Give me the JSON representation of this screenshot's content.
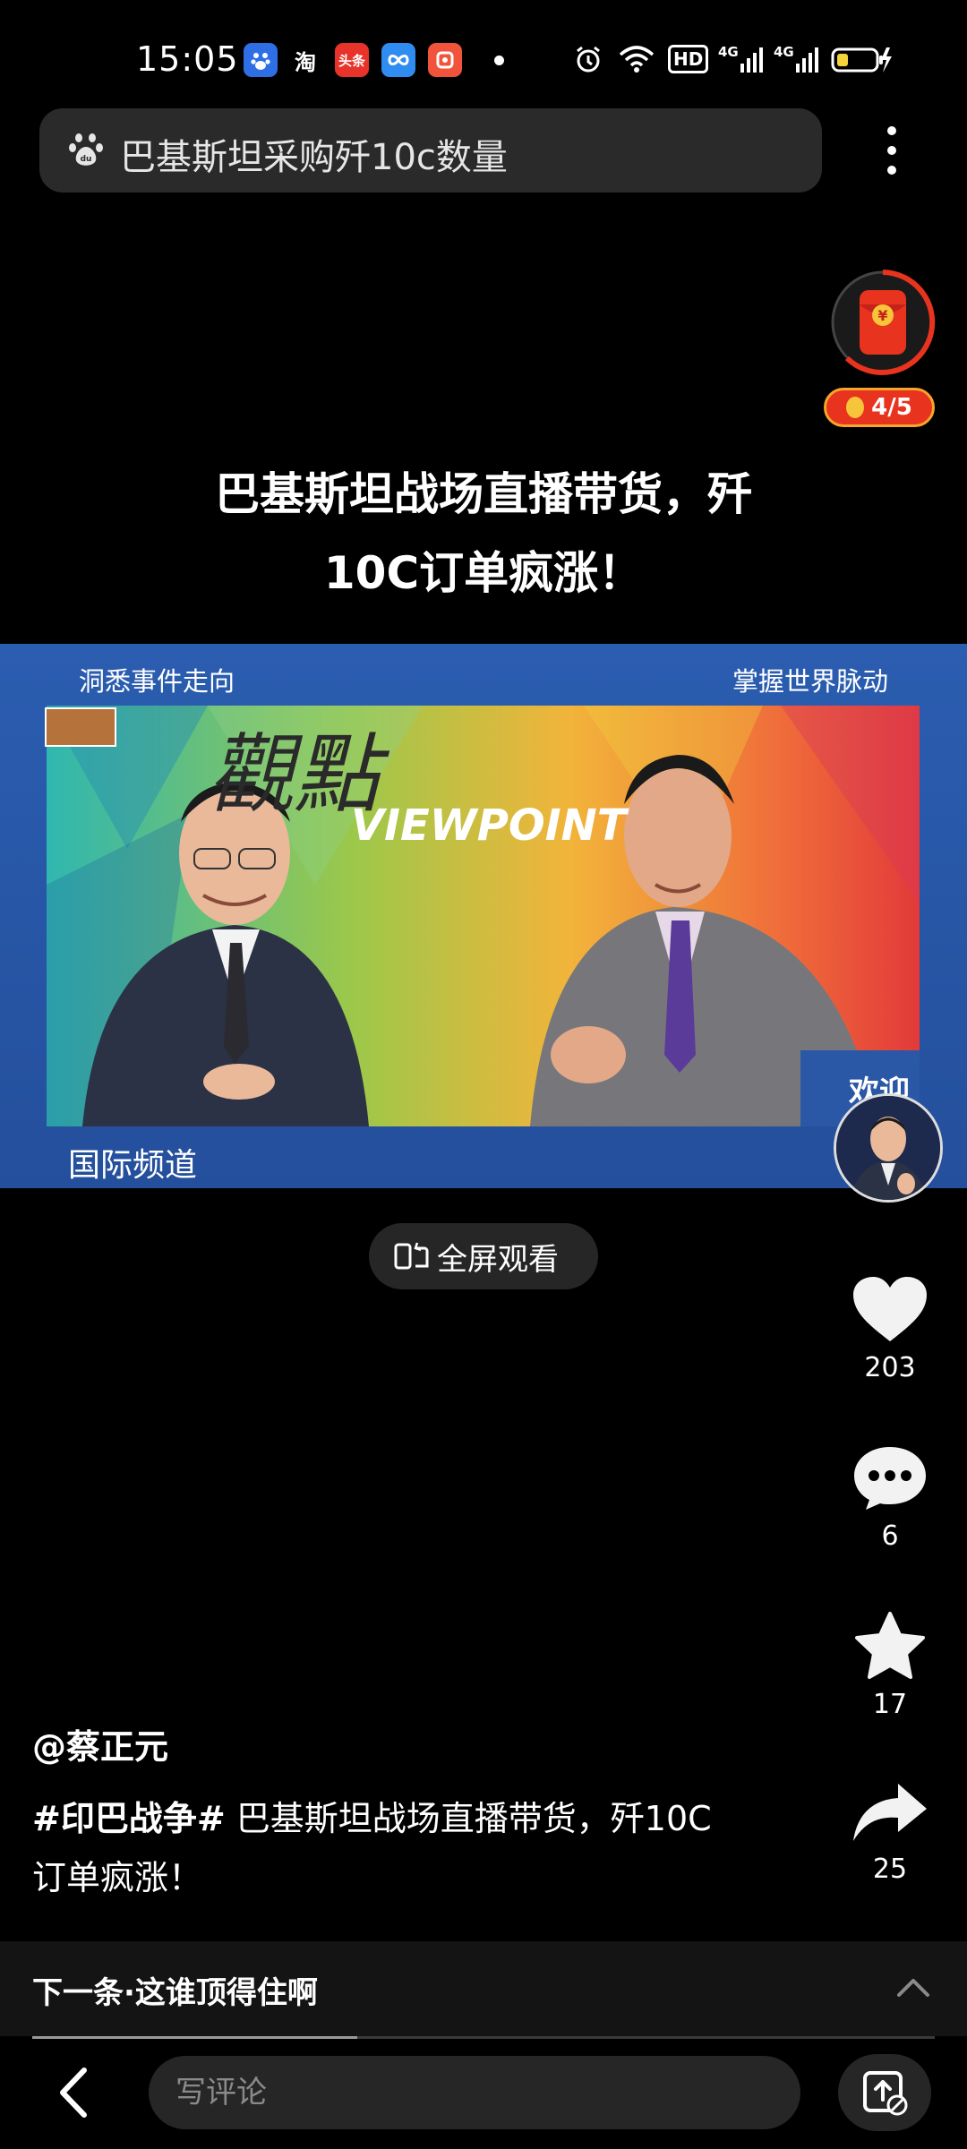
{
  "status_bar": {
    "time": "15:05",
    "app_icons": [
      {
        "name": "baidu-app-icon",
        "text": "",
        "color": "#2f6fe6"
      },
      {
        "name": "taobao-app-icon",
        "text": "淘",
        "color": "#000000"
      },
      {
        "name": "toutiao-app-icon",
        "text": "头条",
        "color": "#e8332a"
      },
      {
        "name": "baidu-netdisk-app-icon",
        "text": "",
        "color": "#2f8cf0"
      },
      {
        "name": "pinduoduo-app-icon",
        "text": "",
        "color": "#f1533b"
      }
    ],
    "hd_label": "HD",
    "network_1": "4G",
    "network_2": "4G"
  },
  "search": {
    "query": "巴基斯坦采购歼10c数量"
  },
  "reward": {
    "progress": "4/5"
  },
  "video": {
    "title_line1": "巴基斯坦战场直播带货，歼",
    "title_line2": "10C订单疯涨！",
    "caption_left": "洞悉事件走向",
    "caption_right": "掌握世界脉动",
    "logo_text": "觀點",
    "logo_sub": "VIEWPOINT",
    "channel": "国际频道",
    "welcome_text": "欢迎",
    "fullscreen_label": "全屏观看"
  },
  "actions": {
    "likes": "203",
    "comments": "6",
    "favorites": "17",
    "shares": "25"
  },
  "post": {
    "author": "@蔡正元",
    "hashtag": "#印巴战争#",
    "description_rest": " 巴基斯坦战场直播带货，歼10C订单疯涨！"
  },
  "next": {
    "label": "下一条·这谁顶得住啊",
    "progress": 0.36
  },
  "bottom": {
    "comment_placeholder": "写评论"
  },
  "colors": {
    "accent_red": "#e8331e",
    "video_bg": "#2a57a6"
  }
}
